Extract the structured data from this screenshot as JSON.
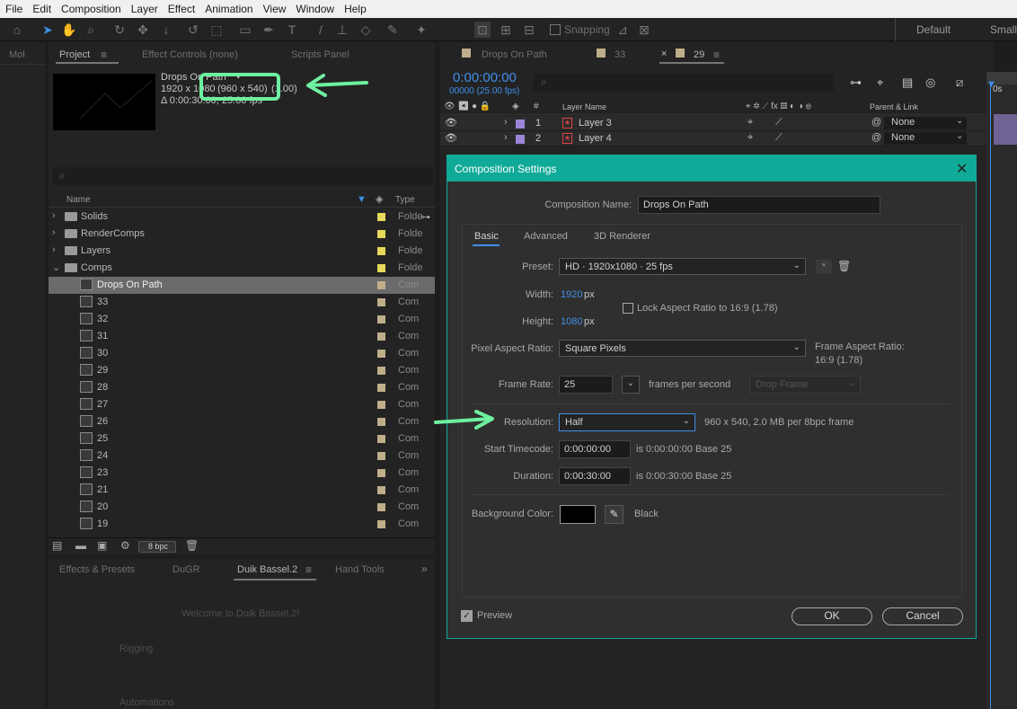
{
  "menu": [
    "File",
    "Edit",
    "Composition",
    "Layer",
    "Effect",
    "Animation",
    "View",
    "Window",
    "Help"
  ],
  "toolbar": {
    "snapping": "Snapping",
    "workspace_default": "Default",
    "workspace_small": "Small"
  },
  "left_strip": {
    "tab": "Mol"
  },
  "project_panel": {
    "tabs": [
      "Project",
      "Effect Controls (none)",
      "Scripts Panel"
    ],
    "preview": {
      "name": "Drops On Path",
      "dimensions": "1920 x 1080",
      "resolution_note": "(960 x 540)",
      "par": "(1.00)",
      "duration": "Δ 0:00:30:00, 25.00 fps"
    },
    "columns": {
      "name": "Name",
      "type": "Type"
    },
    "items": [
      {
        "name": "Solids",
        "kind": "folder",
        "type": "Folde",
        "color": "#e6d85a"
      },
      {
        "name": "RenderComps",
        "kind": "folder",
        "type": "Folde",
        "color": "#e6d85a"
      },
      {
        "name": "Layers",
        "kind": "folder",
        "type": "Folde",
        "color": "#e6d85a"
      },
      {
        "name": "Comps",
        "kind": "folder-open",
        "type": "Folde",
        "color": "#e6d85a"
      },
      {
        "name": "Drops On Path",
        "kind": "comp",
        "type": "Com",
        "color": "#bfae8a",
        "selected": true
      },
      {
        "name": "33",
        "kind": "comp",
        "type": "Com",
        "color": "#bfae8a"
      },
      {
        "name": "32",
        "kind": "comp",
        "type": "Com",
        "color": "#bfae8a"
      },
      {
        "name": "31",
        "kind": "comp",
        "type": "Com",
        "color": "#bfae8a"
      },
      {
        "name": "30",
        "kind": "comp",
        "type": "Com",
        "color": "#bfae8a"
      },
      {
        "name": "29",
        "kind": "comp",
        "type": "Com",
        "color": "#bfae8a"
      },
      {
        "name": "28",
        "kind": "comp",
        "type": "Com",
        "color": "#bfae8a"
      },
      {
        "name": "27",
        "kind": "comp",
        "type": "Com",
        "color": "#bfae8a"
      },
      {
        "name": "26",
        "kind": "comp",
        "type": "Com",
        "color": "#bfae8a"
      },
      {
        "name": "25",
        "kind": "comp",
        "type": "Com",
        "color": "#bfae8a"
      },
      {
        "name": "24",
        "kind": "comp",
        "type": "Com",
        "color": "#bfae8a"
      },
      {
        "name": "23",
        "kind": "comp",
        "type": "Com",
        "color": "#bfae8a"
      },
      {
        "name": "21",
        "kind": "comp",
        "type": "Com",
        "color": "#bfae8a"
      },
      {
        "name": "20",
        "kind": "comp",
        "type": "Com",
        "color": "#bfae8a"
      },
      {
        "name": "19",
        "kind": "comp",
        "type": "Com",
        "color": "#bfae8a"
      }
    ],
    "bpc": "8 bpc"
  },
  "bottom_panel": {
    "tabs": [
      "Effects & Presets",
      "DuGR",
      "Duik Bassel.2",
      "Hand Tools"
    ],
    "welcome": "Welcome to Duik Bassel.2!",
    "rigging": "Rigging",
    "automations": "Automations"
  },
  "timeline": {
    "tabs": [
      "Drops On Path",
      "33",
      "29"
    ],
    "timecode": "0:00:00:00",
    "frames": "00000 (25.00 fps)",
    "columns": {
      "num": "#",
      "layer_name": "Layer Name",
      "parent": "Parent & Link"
    },
    "layers": [
      {
        "num": "1",
        "name": "Layer 3",
        "parent": "None",
        "color": "#9a86d6"
      },
      {
        "name": "Layer 4",
        "num": "2",
        "parent": "None",
        "color": "#9a86d6"
      }
    ],
    "ruler_label": "0s"
  },
  "dialog": {
    "title": "Composition Settings",
    "comp_name_label": "Composition Name:",
    "comp_name": "Drops On Path",
    "tabs": [
      "Basic",
      "Advanced",
      "3D Renderer"
    ],
    "preset_label": "Preset:",
    "preset": "HD  ·  1920x1080 · 25 fps",
    "width_label": "Width:",
    "width": "1920",
    "height_label": "Height:",
    "height": "1080",
    "px": "px",
    "lock_aspect": "Lock Aspect Ratio to 16:9 (1.78)",
    "par_label": "Pixel Aspect Ratio:",
    "par": "Square Pixels",
    "frame_aspect_label": "Frame Aspect Ratio:",
    "frame_aspect": "16:9 (1.78)",
    "frame_rate_label": "Frame Rate:",
    "frame_rate": "25",
    "fps_label": "frames per second",
    "drop_frame": "Drop Frame",
    "resolution_label": "Resolution:",
    "resolution": "Half",
    "resolution_info": "960 x 540, 2.0 MB per 8bpc frame",
    "start_tc_label": "Start Timecode:",
    "start_tc": "0:00:00:00",
    "start_tc_info": "is 0:00:00:00  Base 25",
    "duration_label": "Duration:",
    "duration": "0:00:30:00",
    "duration_info": "is 0:00:30:00  Base 25",
    "bg_label": "Background Color:",
    "bg_name": "Black",
    "preview_label": "Preview",
    "ok": "OK",
    "cancel": "Cancel"
  },
  "colors": {
    "dialog_title": "#10aa98",
    "annotation": "#6ef0a0",
    "link_blue": "#3f8fe8"
  }
}
